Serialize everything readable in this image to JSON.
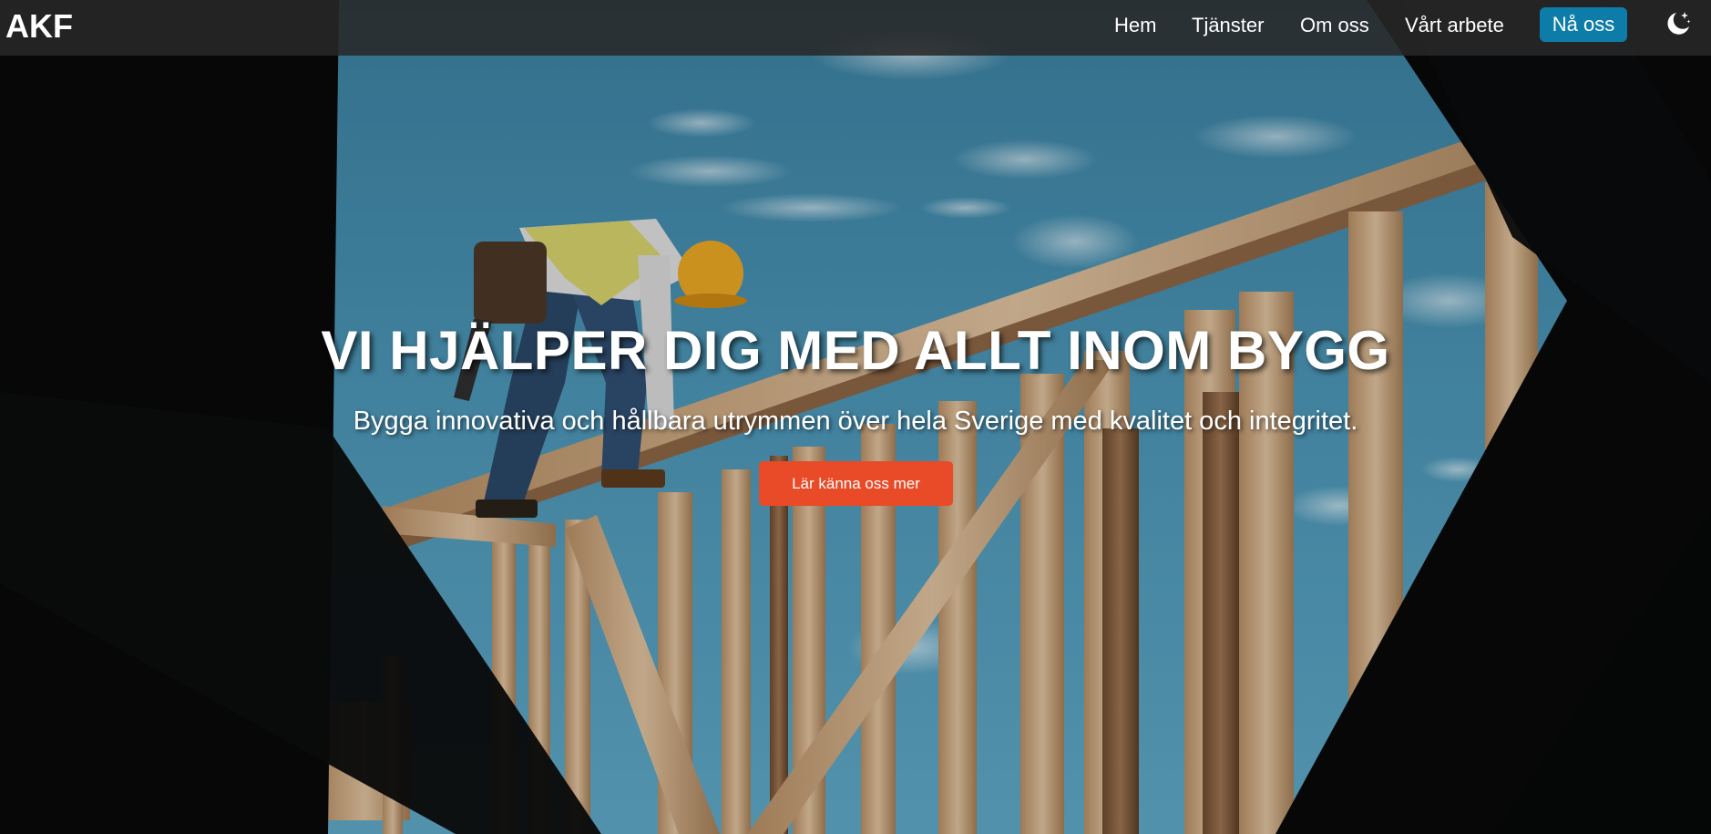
{
  "navbar": {
    "brand": "AKF",
    "links": [
      {
        "label": "Hem"
      },
      {
        "label": "Tjänster"
      },
      {
        "label": "Om oss"
      },
      {
        "label": "Vårt arbete"
      }
    ],
    "cta_label": "Nå oss",
    "theme_toggle_icon": "moon-stars-icon"
  },
  "hero": {
    "title": "VI HJÄLPER DIG MED ALLT INOM BYGG",
    "subtitle": "Bygga innovativa och hållbara utrymmen över hela Sverige med kvalitet och integritet.",
    "button_label": "Lär känna oss mer",
    "background_image": "construction-worker-on-wooden-frame-photo"
  },
  "colors": {
    "navbar_bg": "#282828",
    "cta_bg": "#0e7ca8",
    "hero_button_bg": "#e94a27",
    "sky": "#3e87a6",
    "wood": "#c9a27a",
    "text": "#ffffff"
  }
}
